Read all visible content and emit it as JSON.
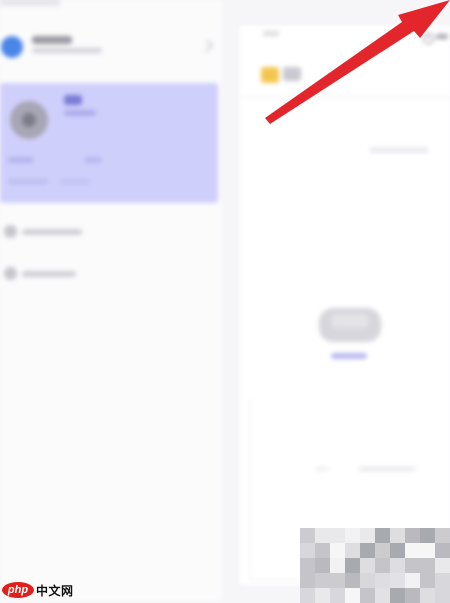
{
  "account": {
    "name": "",
    "subtitle": ""
  },
  "selected_card": {
    "line1": "",
    "line2": "",
    "stat_a": "",
    "stat_b": "",
    "foot_a": "",
    "foot_b": ""
  },
  "menu": {
    "items": [
      {
        "label": "",
        "icon": "circle-icon"
      },
      {
        "label": "",
        "icon": "circle-icon"
      }
    ]
  },
  "right_panel": {
    "tab_label": "",
    "history_label": "",
    "folder_label": "",
    "tools_label": "",
    "empty_action_label": "",
    "footer_hint_a": "",
    "footer_hint_b": ""
  },
  "watermark": {
    "badge": "php",
    "text": "中文网"
  },
  "colors": {
    "selected_card": "#cfcffb",
    "account_avatar": "#4a86e8",
    "folder": "#f4c64f",
    "annotation_arrow": "#e3262b",
    "watermark_badge": "#e0201a"
  }
}
